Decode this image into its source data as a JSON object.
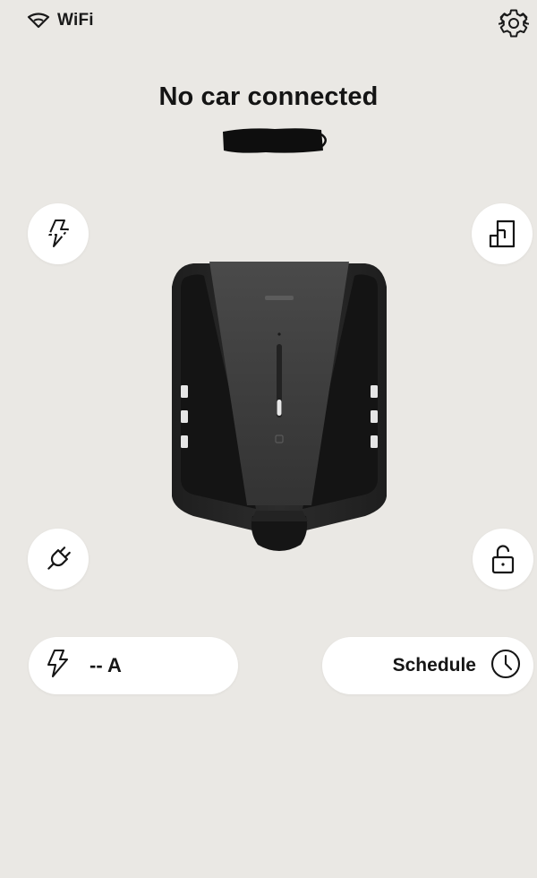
{
  "header": {
    "connection_label": "WiFi"
  },
  "status": {
    "title": "No car connected"
  },
  "controls": {
    "current_label": "-- A",
    "schedule_label": "Schedule"
  },
  "icons": {
    "connection": "wifi-icon",
    "settings": "gear-icon",
    "smart_charging": "lightning-dashed-icon",
    "installation": "floor-plan-icon",
    "cable": "plug-icon",
    "lock": "padlock-unlocked-icon",
    "current": "lightning-icon",
    "schedule": "clock-icon"
  },
  "colors": {
    "background": "#eae8e4",
    "button_surface": "#ffffff",
    "text": "#161616",
    "device_body": "#2a2a2a",
    "device_panel": "#3d3d3d"
  }
}
